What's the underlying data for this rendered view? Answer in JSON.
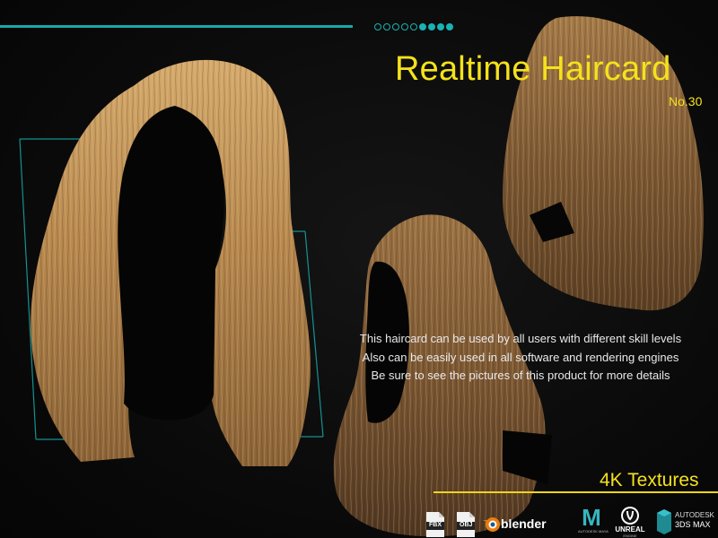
{
  "header": {
    "title": "Realtime Haircard",
    "subtitle": "No.30",
    "progress_dots": {
      "total": 9,
      "filled": 4
    }
  },
  "description": {
    "lines": [
      "This haircard can be used by all users with different skill levels",
      "Also can be easily used in all software and rendering engines",
      "Be sure to see the pictures of this product for more details"
    ]
  },
  "badge": {
    "label": "4K Textures"
  },
  "software_logos": [
    {
      "name": "fbx-icon",
      "label": "FBX"
    },
    {
      "name": "obj-icon",
      "label": "OBJ"
    },
    {
      "name": "blender-icon",
      "label": "blender"
    },
    {
      "name": "maya-icon",
      "label": "M",
      "sub": "AUTODESK MAYA"
    },
    {
      "name": "unreal-icon",
      "label": "UNREAL",
      "sub": "ENGINE"
    },
    {
      "name": "3dsmax-icon",
      "label": "AUTODESK",
      "sub": "3DS MAX"
    }
  ],
  "colors": {
    "accent_teal": "#17a9a9",
    "title_yellow": "#f5e21b",
    "background": "#0b0b0b",
    "hair_light": "#c79a5e",
    "hair_dark": "#6b4a2b"
  }
}
